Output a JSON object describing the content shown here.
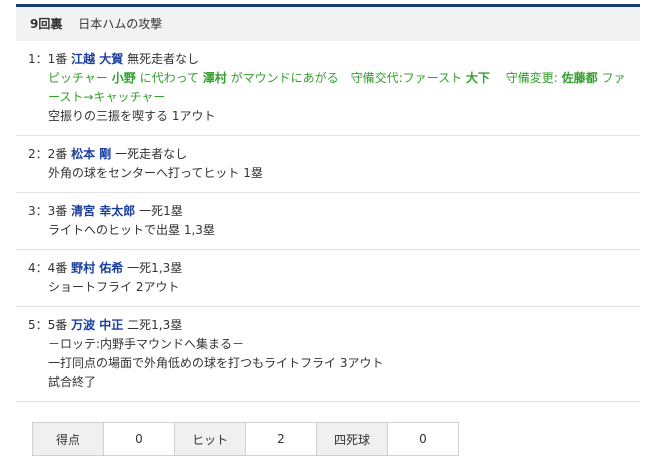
{
  "header": {
    "inning": "9回裏",
    "team_attack": "日本ハムの攻撃"
  },
  "plays": [
    {
      "prefix": "1：1番",
      "batter": "江越 大賀",
      "situation": "無死走者なし",
      "sub": {
        "t1": "ピッチャー",
        "p1": "小野",
        "t2": "に代わって",
        "p2": "澤村",
        "t3": "がマウンドにあがる　守備交代:ファースト",
        "p3": "大下",
        "t4": "　守備変更:",
        "p4": "佐藤都",
        "t5": "ファースト→キャッチャー"
      },
      "result": "空振りの三振を喫する 1アウト"
    },
    {
      "prefix": "2：2番",
      "batter": "松本 剛",
      "situation": "一死走者なし",
      "result": "外角の球をセンターへ打ってヒット 1塁"
    },
    {
      "prefix": "3：3番",
      "batter": "清宮 幸太郎",
      "situation": "一死1塁",
      "result": "ライトへのヒットで出塁 1,3塁"
    },
    {
      "prefix": "4：4番",
      "batter": "野村 佑希",
      "situation": "一死1,3塁",
      "result": "ショートフライ 2アウト"
    },
    {
      "prefix": "5：5番",
      "batter": "万波 中正",
      "situation": "二死1,3塁",
      "note": "－ロッテ:内野手マウンドへ集まる－",
      "result": "一打同点の場面で外角低めの球を打つもライトフライ 3アウト",
      "extra": "試合終了"
    }
  ],
  "stats": [
    {
      "label": "得点",
      "value": "0"
    },
    {
      "label": "ヒット",
      "value": "2"
    },
    {
      "label": "四死球",
      "value": "0"
    }
  ],
  "colors": {
    "accent_bar": "#1a3f6f",
    "player_link": "#1a3f9e",
    "substitution": "#33a02c"
  }
}
